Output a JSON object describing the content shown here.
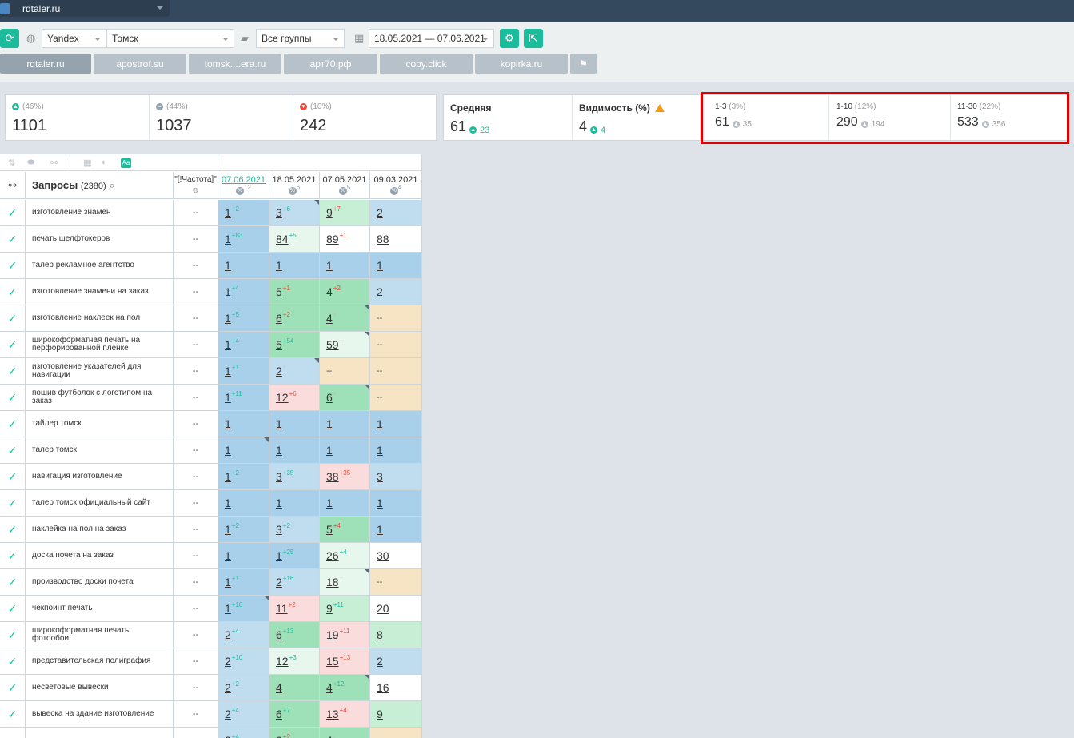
{
  "site": {
    "name": "rdtaler.ru"
  },
  "toolbar": {
    "engine": "Yandex",
    "region": "Томск",
    "group": "Все группы",
    "date_range": "18.05.2021 — 07.06.2021"
  },
  "tabs": [
    {
      "label": "rdtaler.ru",
      "active": true
    },
    {
      "label": "apostrof.su"
    },
    {
      "label": "tomsk....era.ru"
    },
    {
      "label": "арт70.рф"
    },
    {
      "label": "copy.click"
    },
    {
      "label": "kopirka.ru"
    }
  ],
  "stats": {
    "up": {
      "pct": "(46%)",
      "value": "1101"
    },
    "same": {
      "pct": "(44%)",
      "value": "1037"
    },
    "down": {
      "pct": "(10%)",
      "value": "242"
    },
    "avg": {
      "label": "Средняя",
      "value": "61",
      "delta": "23"
    },
    "visibility": {
      "label": "Видимость (%)",
      "value": "4",
      "delta": "4"
    },
    "top3": {
      "label": "1-3",
      "pct": "(3%)",
      "value": "61",
      "delta": "35"
    },
    "top10": {
      "label": "1-10",
      "pct": "(12%)",
      "value": "290",
      "delta": "194"
    },
    "top30": {
      "label": "11-30",
      "pct": "(22%)",
      "value": "533",
      "delta": "356"
    }
  },
  "table": {
    "queries_label": "Запросы",
    "queries_count": "(2380)",
    "freq_label": "\"[!Частота]\"",
    "columns": [
      {
        "date": "07.06.2021",
        "sub": "12",
        "link": true
      },
      {
        "date": "18.05.2021",
        "sub": "6"
      },
      {
        "date": "07.05.2021",
        "sub": "5"
      },
      {
        "date": "09.03.2021",
        "sub": "4"
      }
    ],
    "rows": [
      {
        "q": "изготовление знамен",
        "f": "--",
        "c": [
          [
            "1",
            "+2",
            "up",
            "c-blue"
          ],
          [
            "3",
            "+6",
            "up",
            "c-lblue",
            1
          ],
          [
            "9",
            "+7",
            "dn",
            "c-lgreen"
          ],
          [
            "2",
            "",
            "",
            "c-lblue"
          ]
        ]
      },
      {
        "q": "печать шелфтокеров",
        "f": "--",
        "c": [
          [
            "1",
            "+83",
            "up",
            "c-blue"
          ],
          [
            "84",
            "+5",
            "up",
            "c-vlgreen"
          ],
          [
            "89",
            "+1",
            "dn",
            "c-white"
          ],
          [
            "88",
            "",
            "",
            "c-white"
          ]
        ]
      },
      {
        "q": "талер рекламное агентство",
        "f": "--",
        "c": [
          [
            "1",
            "",
            "",
            "c-blue"
          ],
          [
            "1",
            "",
            "",
            "c-blue"
          ],
          [
            "1",
            "",
            "",
            "c-blue"
          ],
          [
            "1",
            "",
            "",
            "c-blue"
          ]
        ]
      },
      {
        "q": "изготовление знамени на заказ",
        "f": "--",
        "c": [
          [
            "1",
            "+4",
            "up",
            "c-blue"
          ],
          [
            "5",
            "+1",
            "dn",
            "c-green"
          ],
          [
            "4",
            "+2",
            "dn",
            "c-green"
          ],
          [
            "2",
            "",
            "",
            "c-lblue"
          ]
        ]
      },
      {
        "q": "изготовление наклеек на пол",
        "f": "--",
        "c": [
          [
            "1",
            "+5",
            "up",
            "c-blue"
          ],
          [
            "6",
            "+2",
            "dn",
            "c-green"
          ],
          [
            "4",
            "↑",
            "gy",
            "c-green",
            1
          ],
          [
            "--",
            "",
            "",
            "c-tan"
          ]
        ]
      },
      {
        "q": "широкоформатная печать на перфорированной пленке",
        "f": "--",
        "c": [
          [
            "1",
            "+4",
            "up",
            "c-blue"
          ],
          [
            "5",
            "+54",
            "up",
            "c-green"
          ],
          [
            "59",
            "↑",
            "gy",
            "c-vlgreen",
            1
          ],
          [
            "--",
            "",
            "",
            "c-tan"
          ]
        ]
      },
      {
        "q": "изготовление указателей для навигации",
        "f": "--",
        "c": [
          [
            "1",
            "+1",
            "up",
            "c-blue"
          ],
          [
            "2",
            "↑",
            "gy",
            "c-lblue",
            1
          ],
          [
            "--",
            "",
            "",
            "c-tan"
          ],
          [
            "--",
            "",
            "",
            "c-tan"
          ]
        ]
      },
      {
        "q": "пошив футболок с логотипом на заказ",
        "f": "--",
        "c": [
          [
            "1",
            "+11",
            "up",
            "c-blue"
          ],
          [
            "12",
            "+6",
            "dn",
            "c-pink"
          ],
          [
            "6",
            "↑",
            "gy",
            "c-green",
            1
          ],
          [
            "--",
            "",
            "",
            "c-tan"
          ]
        ]
      },
      {
        "q": "тайлер томск",
        "f": "--",
        "c": [
          [
            "1",
            "",
            "",
            "c-blue"
          ],
          [
            "1",
            "",
            "",
            "c-blue"
          ],
          [
            "1",
            "",
            "",
            "c-blue"
          ],
          [
            "1",
            "",
            "",
            "c-blue"
          ]
        ]
      },
      {
        "q": "талер томск",
        "f": "--",
        "c": [
          [
            "1",
            "",
            "",
            "c-blue",
            1
          ],
          [
            "1",
            "",
            "",
            "c-blue"
          ],
          [
            "1",
            "",
            "",
            "c-blue"
          ],
          [
            "1",
            "",
            "",
            "c-blue"
          ]
        ]
      },
      {
        "q": "навигация изготовление",
        "f": "--",
        "c": [
          [
            "1",
            "+2",
            "up",
            "c-blue"
          ],
          [
            "3",
            "+35",
            "up",
            "c-lblue"
          ],
          [
            "38",
            "+35",
            "dn",
            "c-pink"
          ],
          [
            "3",
            "",
            "",
            "c-lblue"
          ]
        ]
      },
      {
        "q": "талер томск официальный сайт",
        "f": "--",
        "c": [
          [
            "1",
            "",
            "",
            "c-blue"
          ],
          [
            "1",
            "",
            "",
            "c-blue"
          ],
          [
            "1",
            "",
            "",
            "c-blue"
          ],
          [
            "1",
            "",
            "",
            "c-blue"
          ]
        ]
      },
      {
        "q": "наклейка на пол на заказ",
        "f": "--",
        "c": [
          [
            "1",
            "+2",
            "up",
            "c-blue"
          ],
          [
            "3",
            "+2",
            "up",
            "c-lblue"
          ],
          [
            "5",
            "+4",
            "dn",
            "c-green"
          ],
          [
            "1",
            "",
            "",
            "c-blue"
          ]
        ]
      },
      {
        "q": "доска почета на заказ",
        "f": "--",
        "c": [
          [
            "1",
            "",
            "",
            "c-blue"
          ],
          [
            "1",
            "+25",
            "up",
            "c-blue"
          ],
          [
            "26",
            "+4",
            "up",
            "c-vlgreen"
          ],
          [
            "30",
            "",
            "",
            "c-white"
          ]
        ]
      },
      {
        "q": "производство доски почета",
        "f": "--",
        "c": [
          [
            "1",
            "+1",
            "up",
            "c-blue"
          ],
          [
            "2",
            "+16",
            "up",
            "c-lblue"
          ],
          [
            "18",
            "↑",
            "gy",
            "c-vlgreen",
            1
          ],
          [
            "--",
            "",
            "",
            "c-tan"
          ]
        ]
      },
      {
        "q": "чекпоинт печать",
        "f": "--",
        "c": [
          [
            "1",
            "+10",
            "up",
            "c-blue",
            1
          ],
          [
            "11",
            "+2",
            "dn",
            "c-pink"
          ],
          [
            "9",
            "+11",
            "up",
            "c-lgreen"
          ],
          [
            "20",
            "",
            "",
            "c-white"
          ]
        ]
      },
      {
        "q": "широкоформатная печать фотообои",
        "f": "--",
        "c": [
          [
            "2",
            "+4",
            "up",
            "c-lblue"
          ],
          [
            "6",
            "+13",
            "up",
            "c-green"
          ],
          [
            "19",
            "+11",
            "dn",
            "c-pink"
          ],
          [
            "8",
            "",
            "",
            "c-lgreen"
          ]
        ]
      },
      {
        "q": "представительская полиграфия",
        "f": "--",
        "c": [
          [
            "2",
            "+10",
            "up",
            "c-lblue"
          ],
          [
            "12",
            "+3",
            "up",
            "c-vlgreen"
          ],
          [
            "15",
            "+13",
            "dn",
            "c-pink"
          ],
          [
            "2",
            "",
            "",
            "c-lblue"
          ]
        ]
      },
      {
        "q": "несветовые вывески",
        "f": "--",
        "c": [
          [
            "2",
            "+2",
            "up",
            "c-lblue"
          ],
          [
            "4",
            "",
            "",
            "c-green"
          ],
          [
            "4",
            "+12",
            "up",
            "c-green",
            1
          ],
          [
            "16",
            "",
            "",
            "c-white"
          ]
        ]
      },
      {
        "q": "вывеска на здание изготовление",
        "f": "--",
        "c": [
          [
            "2",
            "+4",
            "up",
            "c-lblue"
          ],
          [
            "6",
            "+7",
            "up",
            "c-green"
          ],
          [
            "13",
            "+4",
            "dn",
            "c-pink"
          ],
          [
            "9",
            "",
            "",
            "c-lgreen"
          ]
        ]
      },
      {
        "q": "",
        "f": "",
        "c": [
          [
            "2",
            "+4",
            "up",
            "c-lblue"
          ],
          [
            "6",
            "+2",
            "dn",
            "c-green"
          ],
          [
            "4",
            "↑",
            "gy",
            "c-green"
          ],
          [
            "",
            "",
            "",
            "c-tan"
          ]
        ]
      }
    ]
  }
}
